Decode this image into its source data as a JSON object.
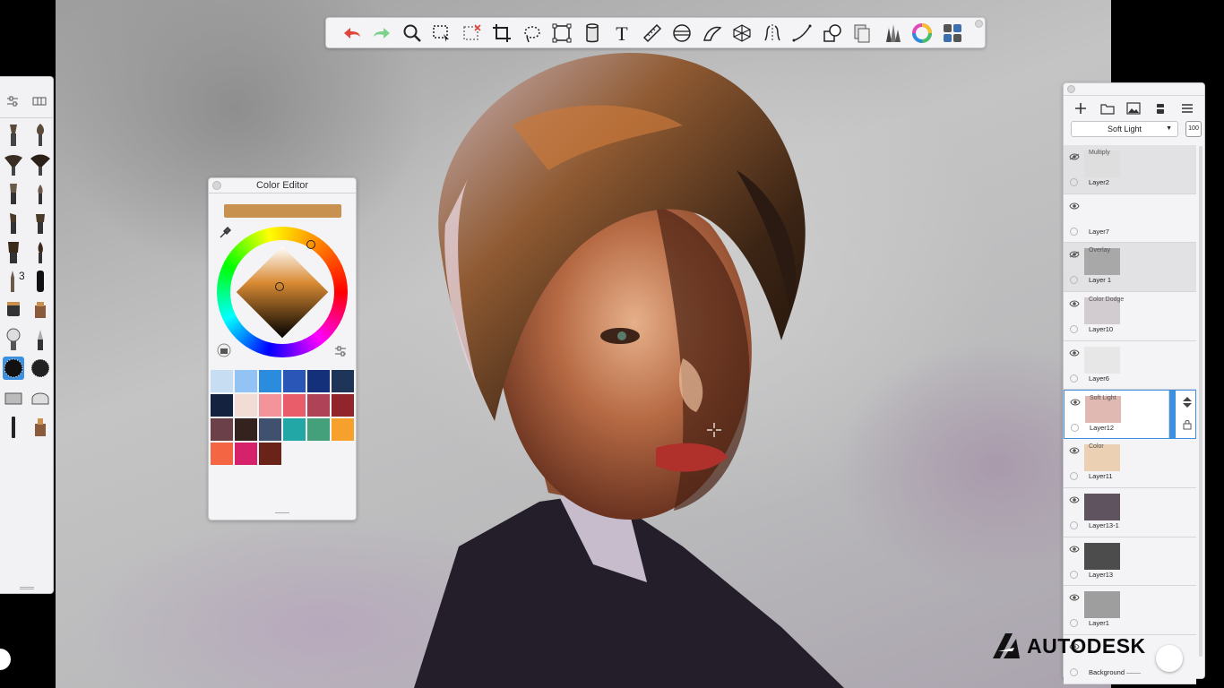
{
  "toolbar": {
    "tools": [
      {
        "name": "undo-icon",
        "color": "#e0473c"
      },
      {
        "name": "redo-icon",
        "color": "#7ed18a"
      },
      {
        "name": "zoom-icon"
      },
      {
        "name": "select-icon"
      },
      {
        "name": "deselect-icon"
      },
      {
        "name": "crop-icon"
      },
      {
        "name": "lasso-icon"
      },
      {
        "name": "transform-icon"
      },
      {
        "name": "fill-icon"
      },
      {
        "name": "text-icon",
        "glyph": "T"
      },
      {
        "name": "ruler-icon"
      },
      {
        "name": "ellipse-guide-icon"
      },
      {
        "name": "french-curve-icon"
      },
      {
        "name": "perspective-icon"
      },
      {
        "name": "symmetry-icon"
      },
      {
        "name": "stroke-icon"
      },
      {
        "name": "shape-icon"
      },
      {
        "name": "copy-layer-icon"
      },
      {
        "name": "brush-library-icon"
      },
      {
        "name": "color-wheel-icon"
      },
      {
        "name": "grid-menu-icon"
      }
    ]
  },
  "brush_panel": {
    "brush_badge": "3"
  },
  "color_editor": {
    "title": "Color Editor",
    "current_color": "#c9914f",
    "palette": [
      "#c7ddf2",
      "#93c2f5",
      "#2b8bdd",
      "#2a56b8",
      "#14307a",
      "#1e3558",
      "#14223f",
      "#f1ddd5",
      "#f2949a",
      "#e85d69",
      "#b04257",
      "#92242b",
      "#6b4048",
      "#34221f",
      "#3f516e",
      "#22a6a6",
      "#43a07a",
      "#f5a12b",
      "#f46544",
      "#d6226a",
      "#6a2318"
    ]
  },
  "layers": {
    "blend_mode": "Soft Light",
    "opacity": "100",
    "items": [
      {
        "name": "Layer2",
        "mode": "Multiply",
        "visible": false
      },
      {
        "name": "Layer7",
        "mode": "",
        "visible": true
      },
      {
        "name": "Layer 1",
        "mode": "Overlay",
        "visible": false
      },
      {
        "name": "Layer10",
        "mode": "Color Dodge",
        "visible": true
      },
      {
        "name": "Layer6",
        "mode": "",
        "visible": true
      },
      {
        "name": "Layer12",
        "mode": "Soft Light",
        "visible": true,
        "active": true
      },
      {
        "name": "Layer11",
        "mode": "Color",
        "visible": true
      },
      {
        "name": "Layer13-1",
        "mode": "",
        "visible": true
      },
      {
        "name": "Layer13",
        "mode": "",
        "visible": true
      },
      {
        "name": "Layer1",
        "mode": "",
        "visible": true
      },
      {
        "name": "Background",
        "mode": "",
        "visible": true
      }
    ]
  },
  "logo": {
    "text": "AUTODESK"
  }
}
